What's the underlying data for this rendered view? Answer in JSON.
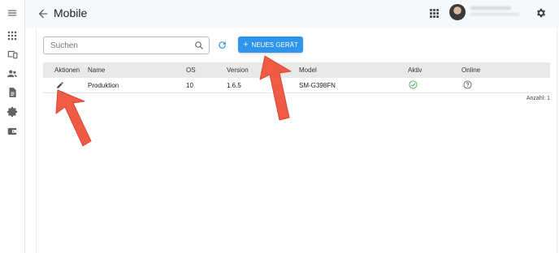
{
  "header": {
    "title": "Mobile"
  },
  "toolbar": {
    "search_placeholder": "Suchen",
    "new_device_label": "NEUES GERÄT",
    "new_device_plus": "+"
  },
  "table": {
    "columns": [
      "Aktionen",
      "Name",
      "OS",
      "Version",
      "Model",
      "Aktiv",
      "Online"
    ],
    "rows": [
      {
        "name": "Produktion",
        "os": "10",
        "version": "1.6.5",
        "model": "SM-G398FN"
      }
    ]
  },
  "footer": {
    "count_label": "Anzahl: 1"
  },
  "colors": {
    "accent": "#2f95ec",
    "active_green": "#4caf50",
    "arrow_red": "#ef5b45"
  },
  "icons": {
    "sidebar": [
      "menu-icon",
      "apps-icon",
      "devices-icon",
      "users-icon",
      "document-icon",
      "settings-icon",
      "wallet-icon"
    ],
    "row_actions": "edit-pencil-icon",
    "row_active": "check-circle-icon",
    "row_online": "help-circle-icon"
  }
}
